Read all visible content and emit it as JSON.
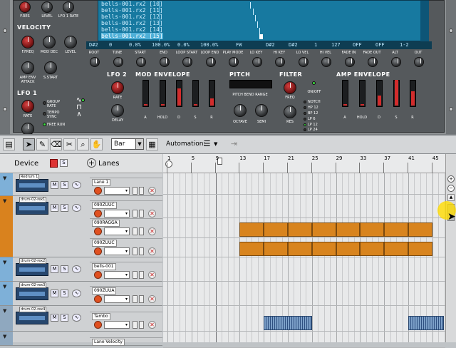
{
  "rack": {
    "top_labels": [
      "F.RES",
      "LEVEL",
      "LFO 1 RATE"
    ],
    "velocity": {
      "title": "VELOCITY",
      "k1": "F.FREQ",
      "k2": "MOD DEC",
      "k3": "LEVEL",
      "k4": "AMP ENV ATTACK",
      "k5": "S.START"
    },
    "lfo1": {
      "title": "LFO 1",
      "rate": "RATE",
      "group_rate": "GROUP RATE",
      "tempo_sync": "TEMPO SYNC",
      "free_run": "FREE RUN"
    },
    "lfo2": {
      "title": "LFO 2",
      "rate": "RATE",
      "delay": "DELAY"
    },
    "mod_env": {
      "title": "MOD ENVELOPE",
      "a": "A",
      "hold": "HOLD",
      "d": "D",
      "s": "S",
      "r": "R"
    },
    "pitch": {
      "title": "PITCH",
      "bend": "PITCH BEND RANGE",
      "octave": "OCTAVE",
      "semi": "SEMI"
    },
    "filter": {
      "title": "FILTER",
      "freq": "FREQ",
      "res": "RES",
      "onoff": "ON/OFF",
      "modes": [
        "NOTCH",
        "HP 12",
        "BP 12",
        "LP 6",
        "LP 12",
        "LP 24"
      ]
    },
    "amp_env": {
      "title": "AMP ENVELOPE",
      "a": "A",
      "hold": "HOLD",
      "d": "D",
      "s": "S",
      "r": "R"
    },
    "param_labels": [
      "ROOT",
      "TUNE",
      "START",
      "END",
      "LOOP START",
      "LOOP END",
      "PLAY MODE",
      "LO KEY",
      "HI KEY",
      "LO VEL",
      "HI VEL",
      "FADE IN",
      "FADE OUT",
      "ALT",
      "OUT"
    ],
    "lcd_samples": [
      "bells-001.rx2 [10]",
      "bells-001.rx2 [11]",
      "bells-001.rx2 [12]",
      "bells-001.rx2 [13]",
      "bells-001.rx2 [14]",
      "bells-001.rx2 [15]"
    ],
    "lcd_bar": [
      "D#2",
      "0",
      "0.0%",
      "100.0%",
      "0.0%",
      "100.0%",
      "FW",
      "D#2",
      "D#2",
      "1",
      "127",
      "OFF",
      "OFF",
      "1-2"
    ]
  },
  "toolbar": {
    "snap_value": "Bar",
    "automation_label": "Automation:"
  },
  "seq_header": {
    "device": "Device",
    "lanes": "Lanes"
  },
  "ruler": [
    "1",
    "5",
    "9",
    "13",
    "17",
    "21",
    "25",
    "29",
    "33",
    "37",
    "41",
    "45"
  ],
  "tracks": [
    {
      "device": "Redrum 1",
      "lanes": [
        "Lane 1"
      ]
    },
    {
      "device": "drum-02-rex1",
      "lanes": [
        "090ZUUC",
        "090RAGGA",
        "090ZUUC"
      ]
    },
    {
      "device": "drum-02-rex2",
      "lanes": [
        "bells-001"
      ]
    },
    {
      "device": "drum-02-rex3",
      "lanes": [
        "090ZUUA"
      ]
    },
    {
      "device": "drum-02-rex4",
      "lanes": [
        "Tambo"
      ]
    },
    {
      "device": "",
      "lanes": [
        "Lane Velocity"
      ]
    }
  ],
  "colors": {
    "rex_clip": "#d8841e",
    "rex_clip_blue": "#4a6fa3",
    "lcd": "#1779a0",
    "fold_orange": "#d9821e"
  }
}
